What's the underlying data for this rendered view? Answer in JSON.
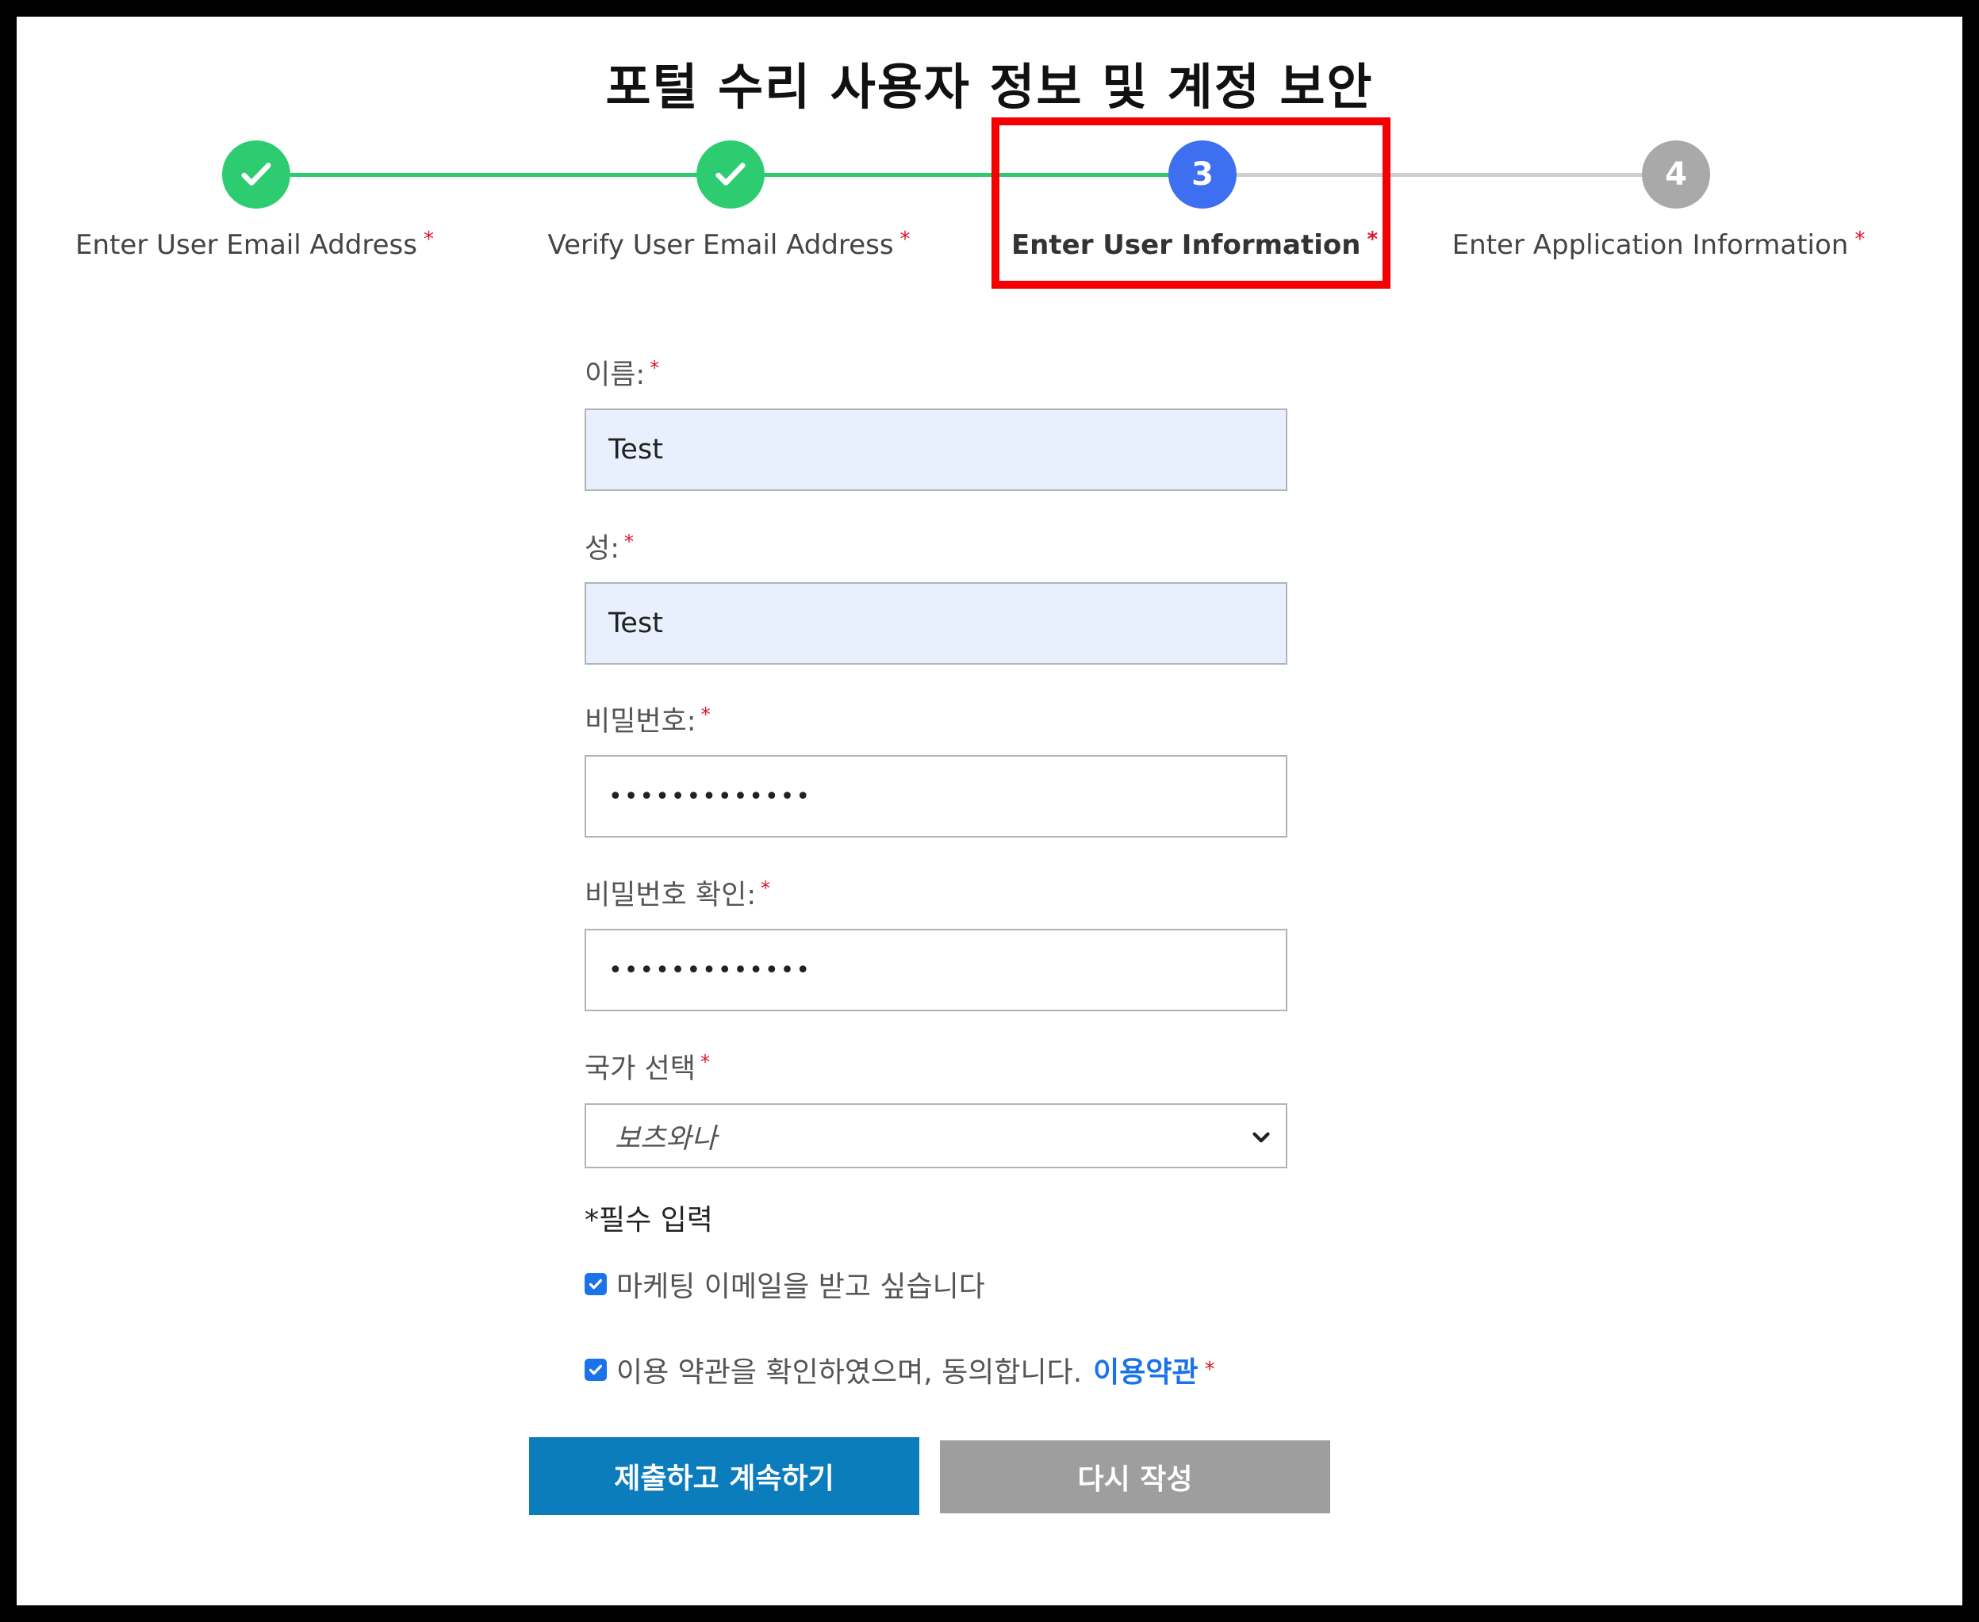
{
  "page": {
    "title": "포털 수리 사용자 정보 및 계정 보안"
  },
  "colors": {
    "complete": "#2ecc71",
    "active": "#3e6ff0",
    "pending": "#a9a9a9",
    "required": "#e0142a",
    "highlight": "#f40000",
    "primary_button": "#0b7cbc",
    "secondary_button": "#9e9e9e",
    "link": "#1a73e8"
  },
  "stepper": {
    "steps": [
      {
        "label": "Enter User Email Address",
        "state": "complete",
        "icon": "check-icon"
      },
      {
        "label": "Verify User Email Address",
        "state": "complete",
        "icon": "check-icon"
      },
      {
        "label": "Enter User Information",
        "state": "active",
        "number": "3"
      },
      {
        "label": "Enter Application Information",
        "state": "pending",
        "number": "4"
      }
    ],
    "required_mark": "*"
  },
  "form": {
    "first_name": {
      "label": "이름:",
      "value": "Test"
    },
    "last_name": {
      "label": "성:",
      "value": "Test"
    },
    "password": {
      "label": "비밀번호:",
      "value": "•••••••••••••"
    },
    "password_confirm": {
      "label": "비밀번호 확인:",
      "value": "•••••••••••••"
    },
    "country": {
      "label": "국가 선택",
      "selected": "보츠와나"
    },
    "required_note": "*필수 입력",
    "marketing_opt_in": {
      "label": "마케팅 이메일을 받고 싶습니다",
      "checked": true
    },
    "terms": {
      "label": "이용 약관을 확인하였으며, 동의합니다.",
      "link_text": "이용약관",
      "checked": true
    }
  },
  "buttons": {
    "submit": "제출하고 계속하기",
    "reset": "다시 작성"
  }
}
